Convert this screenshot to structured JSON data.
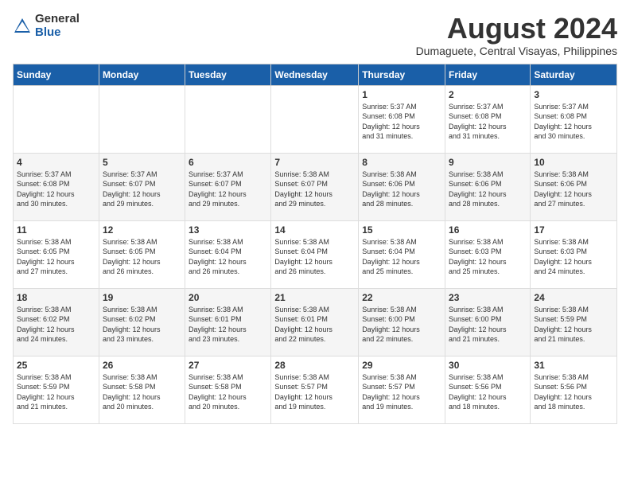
{
  "logo": {
    "general": "General",
    "blue": "Blue"
  },
  "title": "August 2024",
  "location": "Dumaguete, Central Visayas, Philippines",
  "days_of_week": [
    "Sunday",
    "Monday",
    "Tuesday",
    "Wednesday",
    "Thursday",
    "Friday",
    "Saturday"
  ],
  "weeks": [
    {
      "days": [
        {
          "number": "",
          "info": ""
        },
        {
          "number": "",
          "info": ""
        },
        {
          "number": "",
          "info": ""
        },
        {
          "number": "",
          "info": ""
        },
        {
          "number": "1",
          "info": "Sunrise: 5:37 AM\nSunset: 6:08 PM\nDaylight: 12 hours\nand 31 minutes."
        },
        {
          "number": "2",
          "info": "Sunrise: 5:37 AM\nSunset: 6:08 PM\nDaylight: 12 hours\nand 31 minutes."
        },
        {
          "number": "3",
          "info": "Sunrise: 5:37 AM\nSunset: 6:08 PM\nDaylight: 12 hours\nand 30 minutes."
        }
      ]
    },
    {
      "days": [
        {
          "number": "4",
          "info": "Sunrise: 5:37 AM\nSunset: 6:08 PM\nDaylight: 12 hours\nand 30 minutes."
        },
        {
          "number": "5",
          "info": "Sunrise: 5:37 AM\nSunset: 6:07 PM\nDaylight: 12 hours\nand 29 minutes."
        },
        {
          "number": "6",
          "info": "Sunrise: 5:37 AM\nSunset: 6:07 PM\nDaylight: 12 hours\nand 29 minutes."
        },
        {
          "number": "7",
          "info": "Sunrise: 5:38 AM\nSunset: 6:07 PM\nDaylight: 12 hours\nand 29 minutes."
        },
        {
          "number": "8",
          "info": "Sunrise: 5:38 AM\nSunset: 6:06 PM\nDaylight: 12 hours\nand 28 minutes."
        },
        {
          "number": "9",
          "info": "Sunrise: 5:38 AM\nSunset: 6:06 PM\nDaylight: 12 hours\nand 28 minutes."
        },
        {
          "number": "10",
          "info": "Sunrise: 5:38 AM\nSunset: 6:06 PM\nDaylight: 12 hours\nand 27 minutes."
        }
      ]
    },
    {
      "days": [
        {
          "number": "11",
          "info": "Sunrise: 5:38 AM\nSunset: 6:05 PM\nDaylight: 12 hours\nand 27 minutes."
        },
        {
          "number": "12",
          "info": "Sunrise: 5:38 AM\nSunset: 6:05 PM\nDaylight: 12 hours\nand 26 minutes."
        },
        {
          "number": "13",
          "info": "Sunrise: 5:38 AM\nSunset: 6:04 PM\nDaylight: 12 hours\nand 26 minutes."
        },
        {
          "number": "14",
          "info": "Sunrise: 5:38 AM\nSunset: 6:04 PM\nDaylight: 12 hours\nand 26 minutes."
        },
        {
          "number": "15",
          "info": "Sunrise: 5:38 AM\nSunset: 6:04 PM\nDaylight: 12 hours\nand 25 minutes."
        },
        {
          "number": "16",
          "info": "Sunrise: 5:38 AM\nSunset: 6:03 PM\nDaylight: 12 hours\nand 25 minutes."
        },
        {
          "number": "17",
          "info": "Sunrise: 5:38 AM\nSunset: 6:03 PM\nDaylight: 12 hours\nand 24 minutes."
        }
      ]
    },
    {
      "days": [
        {
          "number": "18",
          "info": "Sunrise: 5:38 AM\nSunset: 6:02 PM\nDaylight: 12 hours\nand 24 minutes."
        },
        {
          "number": "19",
          "info": "Sunrise: 5:38 AM\nSunset: 6:02 PM\nDaylight: 12 hours\nand 23 minutes."
        },
        {
          "number": "20",
          "info": "Sunrise: 5:38 AM\nSunset: 6:01 PM\nDaylight: 12 hours\nand 23 minutes."
        },
        {
          "number": "21",
          "info": "Sunrise: 5:38 AM\nSunset: 6:01 PM\nDaylight: 12 hours\nand 22 minutes."
        },
        {
          "number": "22",
          "info": "Sunrise: 5:38 AM\nSunset: 6:00 PM\nDaylight: 12 hours\nand 22 minutes."
        },
        {
          "number": "23",
          "info": "Sunrise: 5:38 AM\nSunset: 6:00 PM\nDaylight: 12 hours\nand 21 minutes."
        },
        {
          "number": "24",
          "info": "Sunrise: 5:38 AM\nSunset: 5:59 PM\nDaylight: 12 hours\nand 21 minutes."
        }
      ]
    },
    {
      "days": [
        {
          "number": "25",
          "info": "Sunrise: 5:38 AM\nSunset: 5:59 PM\nDaylight: 12 hours\nand 21 minutes."
        },
        {
          "number": "26",
          "info": "Sunrise: 5:38 AM\nSunset: 5:58 PM\nDaylight: 12 hours\nand 20 minutes."
        },
        {
          "number": "27",
          "info": "Sunrise: 5:38 AM\nSunset: 5:58 PM\nDaylight: 12 hours\nand 20 minutes."
        },
        {
          "number": "28",
          "info": "Sunrise: 5:38 AM\nSunset: 5:57 PM\nDaylight: 12 hours\nand 19 minutes."
        },
        {
          "number": "29",
          "info": "Sunrise: 5:38 AM\nSunset: 5:57 PM\nDaylight: 12 hours\nand 19 minutes."
        },
        {
          "number": "30",
          "info": "Sunrise: 5:38 AM\nSunset: 5:56 PM\nDaylight: 12 hours\nand 18 minutes."
        },
        {
          "number": "31",
          "info": "Sunrise: 5:38 AM\nSunset: 5:56 PM\nDaylight: 12 hours\nand 18 minutes."
        }
      ]
    }
  ]
}
